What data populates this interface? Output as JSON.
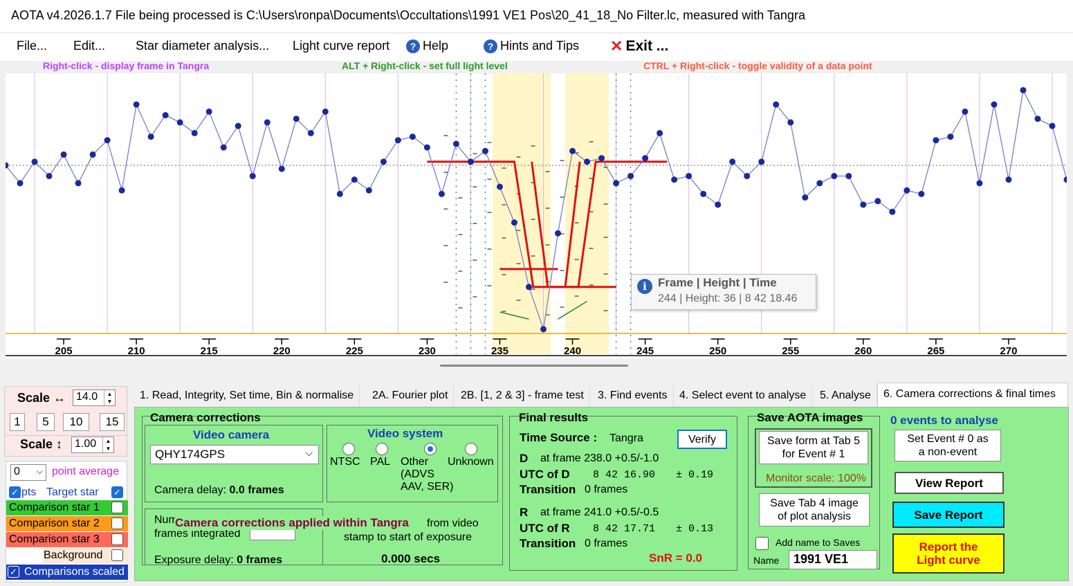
{
  "window": {
    "title": "AOTA v4.2026.1.7     File being processed is C:\\Users\\ronpa\\Documents\\Occultations\\1991 VE1 Pos\\20_41_18_No Filter.lc, measured with Tangra"
  },
  "menu": {
    "file": "File...",
    "edit": "Edit...",
    "star_diameter": "Star diameter analysis...",
    "light_curve_report": "Light curve report",
    "help": "Help",
    "hints": "Hints and Tips",
    "exit": "Exit ..."
  },
  "hints": {
    "right_click": "Right-click  -  display frame in Tangra",
    "alt_right_click": "ALT + Right-click  -  set full light level",
    "ctrl_right_click": "CTRL + Right-click  -  toggle validity of a data point"
  },
  "colors": {
    "hint_right": "#c040ff",
    "hint_alt": "#2a9a2a",
    "hint_ctrl": "#ff5a3c",
    "green_panel": "#90ee90",
    "event_line": "#e01010",
    "data_line": "#3030c8",
    "highlight": "#fff6c8"
  },
  "chart_data": {
    "type": "line",
    "x_ticks": [
      205,
      210,
      215,
      220,
      225,
      230,
      235,
      240,
      245,
      250,
      255,
      260,
      265,
      270
    ],
    "xlim": [
      201,
      274
    ],
    "ylim": [
      30,
      380
    ],
    "highlight_ranges": [
      [
        235,
        238
      ],
      [
        240,
        242
      ]
    ],
    "series": [
      {
        "x": [
          201,
          202,
          203,
          204,
          205,
          206,
          207,
          208,
          209,
          210,
          211,
          212,
          213,
          214,
          215,
          216,
          217,
          218,
          219,
          220,
          221,
          222,
          223,
          224,
          225,
          226,
          227,
          228,
          229,
          230,
          231,
          232,
          233,
          234,
          235,
          236,
          237,
          238,
          239,
          240,
          241,
          242,
          243,
          244,
          245,
          246,
          247,
          248,
          249,
          250,
          251,
          252,
          253,
          254,
          255,
          256,
          257,
          258,
          259,
          260,
          261,
          262,
          263,
          264,
          265,
          266,
          267,
          268,
          269,
          270,
          271,
          272,
          273,
          274
        ],
        "y": [
          265,
          240,
          270,
          250,
          280,
          240,
          280,
          300,
          230,
          350,
          305,
          335,
          325,
          310,
          340,
          290,
          320,
          250,
          325,
          260,
          330,
          310,
          340,
          225,
          245,
          230,
          270,
          300,
          305,
          290,
          225,
          295,
          270,
          285,
          235,
          185,
          95,
          36,
          170,
          285,
          270,
          275,
          240,
          250,
          275,
          310,
          245,
          250,
          225,
          210,
          270,
          250,
          270,
          350,
          325,
          220,
          240,
          250,
          250,
          210,
          215,
          200,
          230,
          225,
          300,
          305,
          340,
          240,
          350,
          245,
          370,
          330,
          320,
          245
        ]
      }
    ]
  },
  "tooltip": {
    "title": "Frame | Height | Time",
    "value": "244 | Height: 36 |  8 42 18.46"
  },
  "left_panel": {
    "scale_h_label": "Scale ↔",
    "scale_h_value": "14.0",
    "scale_buttons": [
      "1",
      "5",
      "10",
      "15"
    ],
    "scale_v_label": "Scale ↕",
    "scale_v_value": "1.00",
    "point_average_value": "0",
    "point_average_label": "point average",
    "pts_label": "pts",
    "target_star": "Target star",
    "comp1": "Comparison star 1",
    "comp2": "Comparison star 2",
    "comp3": "Comparison star 3",
    "background": "Background",
    "comparisons_scaled": "Comparisons scaled"
  },
  "tabs": [
    "1.  Read, Integrity, Set time, Bin & normalise",
    "2A. Fourier plot",
    "2B. [1, 2 & 3] - frame test",
    "3. Find events",
    "4. Select event to analyse",
    "5. Analyse",
    "6. Camera corrections & final times"
  ],
  "camera": {
    "group_title": "Camera corrections",
    "video_camera_label": "Video camera",
    "camera_value": "QHY174GPS",
    "camera_delay_label": "Camera delay:",
    "camera_delay_value": "0.0 frames",
    "video_system_label": "Video system",
    "ntsc": "NTSC",
    "pal": "PAL",
    "other": "Other",
    "other_sub1": "(ADVS",
    "other_sub2": "AAV, SER)",
    "unknown": "Unknown",
    "num_frames_label1": "Num",
    "num_frames_label2": "frames integrated",
    "overlay_text": "Camera corrections applied within Tangra",
    "from_video_text": "from video",
    "stamp_text": "stamp to start of exposure",
    "exposure_delay_label": "Exposure delay:",
    "exposure_delay_value": "0 frames",
    "secs_value": "0.000 secs"
  },
  "final": {
    "title": "Final results",
    "time_source_label": "Time Source :",
    "time_source_value": "Tangra",
    "verify": "Verify",
    "d_label": "D",
    "d_frame": "at frame 238.0  +0.5/-1.0",
    "utc_d_label": "UTC of D",
    "utc_d_value": "8  42  16.90",
    "utc_d_err": "± 0.19",
    "transition_label": "Transition",
    "transition_d": "0 frames",
    "r_label": "R",
    "r_frame": "at frame 241.0  +0.5/-0.5",
    "utc_r_label": "UTC of R",
    "utc_r_value": "8  42  17.71",
    "utc_r_err": "± 0.13",
    "transition_r": "0 frames",
    "snr": "SnR = 0.0"
  },
  "save": {
    "title": "Save AOTA images",
    "save_form": "Save form at Tab 5\nfor Event # 1",
    "monitor_scale": "Monitor scale: 100%",
    "save_tab4": "Save Tab 4 image\nof plot analysis",
    "add_name": "Add name to Saves",
    "name_label": "Name",
    "name_value": "1991 VE1"
  },
  "events": {
    "title": "0  events to analyse",
    "set_event": "Set Event # 0 as\na non-event",
    "view_report": "View Report",
    "save_report": "Save Report",
    "report_lc": "Report the\nLight curve"
  }
}
